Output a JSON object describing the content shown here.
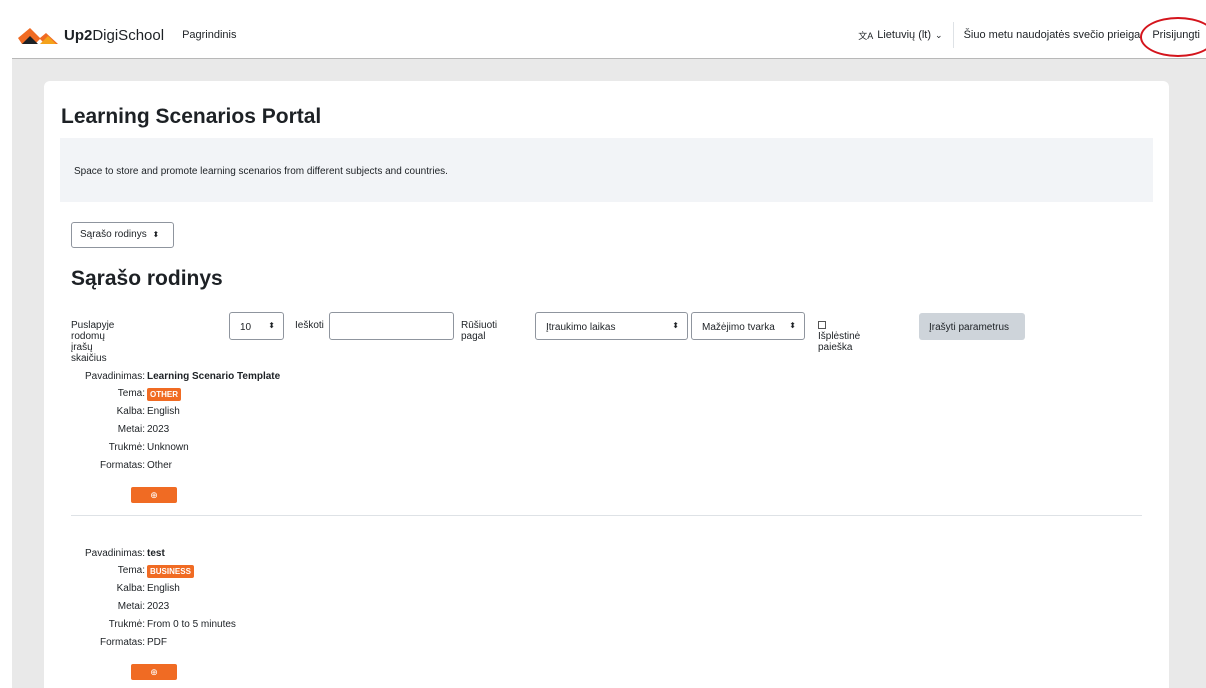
{
  "navbar": {
    "brand_bold": "Up2",
    "brand_rest": "DigiSchool",
    "home": "Pagrindinis",
    "language": "Lietuvių (lt)",
    "language_caret": "⌄",
    "guest_notice": "Šiuo metu naudojatės svečio prieiga",
    "login": "Prisijungti"
  },
  "page": {
    "title": "Learning Scenarios Portal",
    "intro": "Space to store and promote learning scenarios from different subjects and countries.",
    "view_select": "Sąrašo rodinys",
    "section_title": "Sąrašo rodinys"
  },
  "controls": {
    "per_page_label": "Puslapyje rodomų įrašų skaičius",
    "per_page_value": "10",
    "search_label": "Ieškoti",
    "search_value": "",
    "sort_label": "Rūšiuoti pagal",
    "sort_value": "Įtraukimo laikas",
    "order_value": "Mažėjimo tvarka",
    "advanced_label": "Išplėstinė paieška",
    "save_button": "Įrašyti parametrus"
  },
  "field_labels": {
    "name": "Pavadinimas:",
    "topic": "Tema:",
    "language": "Kalba:",
    "year": "Metai:",
    "duration": "Trukmė:",
    "format": "Formatas:"
  },
  "entries": [
    {
      "name": "Learning Scenario Template",
      "topic": "OTHER",
      "language": "English",
      "year": "2023",
      "duration": "Unknown",
      "format": "Other"
    },
    {
      "name": "test",
      "topic": "BUSINESS",
      "language": "English",
      "year": "2023",
      "duration": "From 0 to 5 minutes",
      "format": "PDF"
    }
  ],
  "colors": {
    "accent": "#f06b23",
    "highlight_ring": "#d4141c",
    "page_bg": "#e9e9e9"
  },
  "icons": {
    "select_caret": "⬍",
    "zoom": "⊕"
  }
}
